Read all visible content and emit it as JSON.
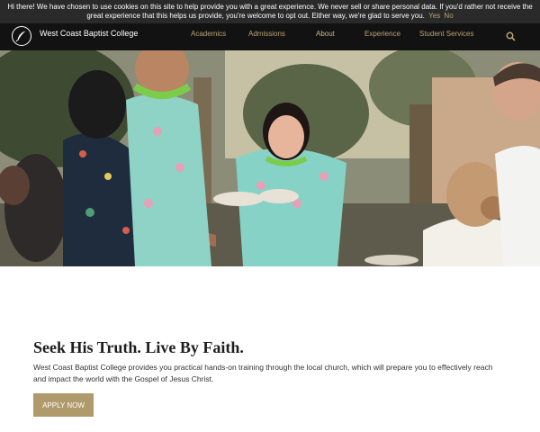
{
  "cookie_banner": {
    "message": "Hi there! We have chosen to use cookies on this site to help provide you with a great experience. We never sell or share personal data. If you'd rather not receive the great experience that this helps us provide, you're welcome to opt out. Either way, we're glad to serve you.",
    "yes_label": "Yes",
    "no_label": "No"
  },
  "header": {
    "brand": "West Coast Baptist College",
    "nav": [
      "Academics",
      "Admissions",
      "About",
      "Experience",
      "Student Services"
    ],
    "search_icon": "search-icon",
    "logo_icon": "feather-icon"
  },
  "hero": {
    "description": "photo of students in matching floral shirts and green leis holding food trays outdoors"
  },
  "main": {
    "tagline": "Seek His Truth. Live By Faith.",
    "description": "West Coast Baptist College provides you practical hands-on training through the local church, which will prepare you to effectively reach and impact the world with the Gospel of Jesus Christ.",
    "apply_label": "APPLY NOW"
  },
  "colors": {
    "accent": "#b09a6c",
    "navbar": "#121212",
    "cookie_bar": "#2a2a2a"
  }
}
